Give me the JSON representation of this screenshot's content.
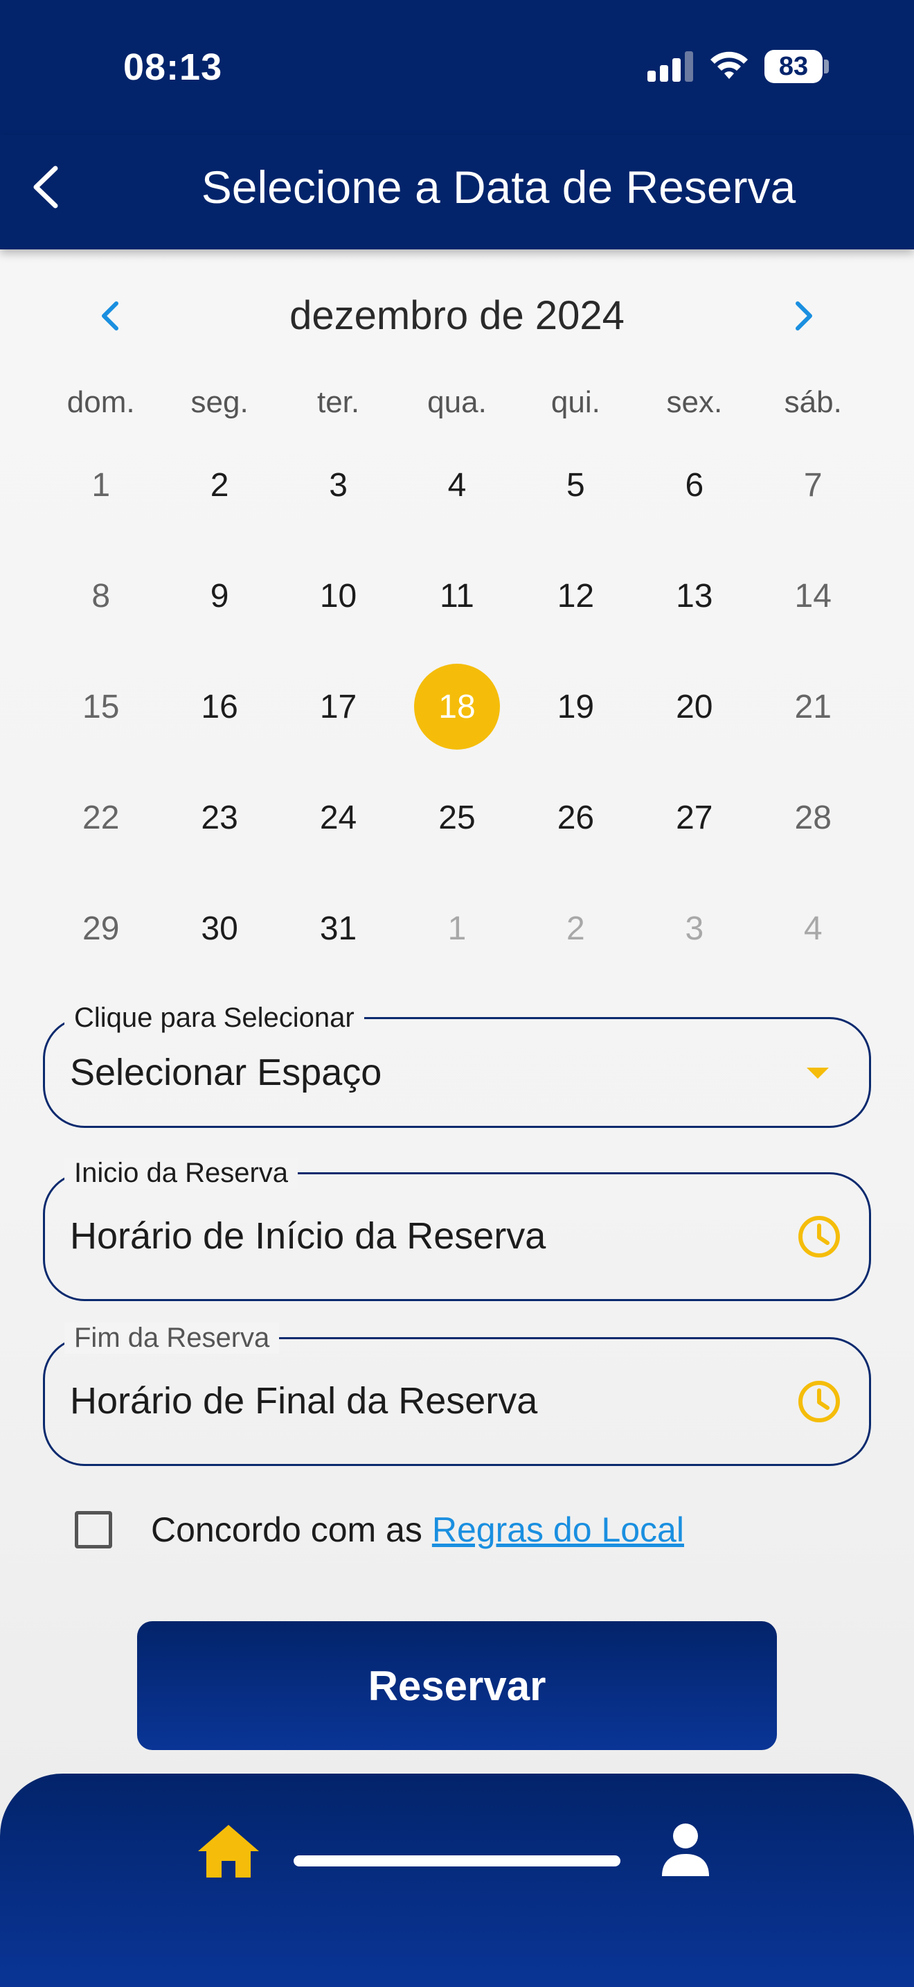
{
  "status_bar": {
    "time": "08:13",
    "battery": "83"
  },
  "header": {
    "title": "Selecione a Data de Reserva"
  },
  "calendar": {
    "month_label": "dezembro de 2024",
    "weekdays": [
      "dom.",
      "seg.",
      "ter.",
      "qua.",
      "qui.",
      "sex.",
      "sáb."
    ],
    "weeks": [
      [
        "1",
        "2",
        "3",
        "4",
        "5",
        "6",
        "7"
      ],
      [
        "8",
        "9",
        "10",
        "11",
        "12",
        "13",
        "14"
      ],
      [
        "15",
        "16",
        "17",
        "18",
        "19",
        "20",
        "21"
      ],
      [
        "22",
        "23",
        "24",
        "25",
        "26",
        "27",
        "28"
      ],
      [
        "29",
        "30",
        "31",
        "1",
        "2",
        "3",
        "4"
      ]
    ],
    "selected_day": "18",
    "accent_color": "#f5bd0a"
  },
  "form": {
    "space_field": {
      "label": "Clique para Selecionar",
      "value": "Selecionar Espaço"
    },
    "start_field": {
      "label": "Inicio da Reserva",
      "value": "Horário de Início da Reserva"
    },
    "end_field": {
      "label": "Fim da Reserva",
      "value": "Horário de Final da Reserva"
    },
    "agree_text": "Concordo com as",
    "agree_link": "Regras do Local",
    "submit_label": "Reservar"
  },
  "bottom_nav": {
    "items": [
      {
        "icon": "home-icon",
        "active": true
      },
      {
        "icon": "profile-icon",
        "active": false
      }
    ]
  },
  "colors": {
    "primary": "#03246b",
    "accent": "#f5bd0a",
    "link": "#1a8fe0"
  }
}
